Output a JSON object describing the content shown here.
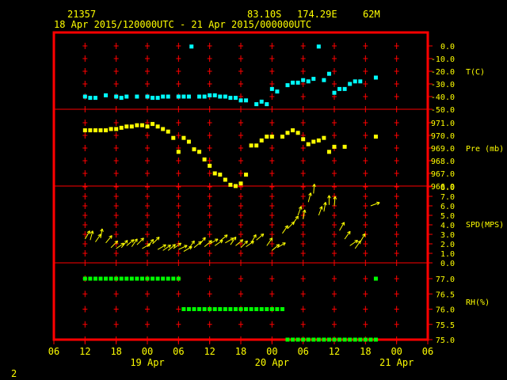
{
  "header": {
    "station": "21357",
    "latitude": "83.10S",
    "longitude": "174.29E",
    "elevation": "62M",
    "date_range": "18 Apr 2015/120000UTC - 21 Apr 2015/000000UTC"
  },
  "page_number": "2",
  "colors": {
    "background": "#000000",
    "frame": "#ff0000",
    "gridline": "#ff0000",
    "tick_labels": "#ffff00",
    "temperature": "#00ffff",
    "pressure": "#ffff00",
    "wind": "#ffff00",
    "humidity": "#00ff00"
  },
  "chart_data": {
    "type": "scatter",
    "x_axis": {
      "ticks": [
        "06",
        "12",
        "18",
        "00",
        "06",
        "12",
        "18",
        "00",
        "06",
        "12",
        "18",
        "00",
        "06"
      ],
      "day_labels": [
        "19 Apr",
        "20 Apr",
        "21 Apr"
      ],
      "range_hours_since_18Apr_00UTC": [
        6,
        78
      ]
    },
    "panels": [
      {
        "name": "temperature",
        "label": "T(C)",
        "ticks": [
          "0.0",
          "-10.0",
          "-20.0",
          "-30.0",
          "-40.0",
          "-50.0"
        ],
        "range": [
          -50,
          0
        ],
        "points": [
          [
            12,
            -40
          ],
          [
            13,
            -41
          ],
          [
            14,
            -41
          ],
          [
            16,
            -39
          ],
          [
            18,
            -40
          ],
          [
            19,
            -41
          ],
          [
            20,
            -40
          ],
          [
            22,
            -40
          ],
          [
            24,
            -40
          ],
          [
            25,
            -41
          ],
          [
            26,
            -41
          ],
          [
            27,
            -40
          ],
          [
            28,
            -40
          ],
          [
            30,
            -40
          ],
          [
            31,
            -40
          ],
          [
            32,
            -40
          ],
          [
            32.5,
            -0.5
          ],
          [
            34,
            -40
          ],
          [
            35,
            -40
          ],
          [
            36,
            -39
          ],
          [
            37,
            -39
          ],
          [
            38,
            -40
          ],
          [
            39,
            -40
          ],
          [
            40,
            -41
          ],
          [
            41,
            -41
          ],
          [
            42,
            -43
          ],
          [
            43,
            -43
          ],
          [
            45,
            -46
          ],
          [
            46,
            -44
          ],
          [
            47,
            -46
          ],
          [
            48,
            -34
          ],
          [
            49,
            -36
          ],
          [
            51,
            -31
          ],
          [
            52,
            -29
          ],
          [
            53,
            -29
          ],
          [
            54,
            -27
          ],
          [
            55,
            -28
          ],
          [
            56,
            -26
          ],
          [
            57,
            -0.5
          ],
          [
            58,
            -27
          ],
          [
            59,
            -22
          ],
          [
            60,
            -37
          ],
          [
            61,
            -34
          ],
          [
            62,
            -34
          ],
          [
            63,
            -30
          ],
          [
            64,
            -28
          ],
          [
            65,
            -28
          ],
          [
            68,
            -25
          ]
        ]
      },
      {
        "name": "pressure",
        "label": "Pre (mb)",
        "ticks": [
          "971.0",
          "970.0",
          "969.0",
          "968.0",
          "967.0",
          "966.0"
        ],
        "range": [
          966,
          971
        ],
        "points": [
          [
            12,
            970.4
          ],
          [
            13,
            970.4
          ],
          [
            14,
            970.4
          ],
          [
            15,
            970.4
          ],
          [
            16,
            970.4
          ],
          [
            17,
            970.5
          ],
          [
            18,
            970.5
          ],
          [
            19,
            970.6
          ],
          [
            20,
            970.7
          ],
          [
            21,
            970.7
          ],
          [
            22,
            970.8
          ],
          [
            23,
            970.8
          ],
          [
            24,
            970.7
          ],
          [
            25,
            970.9
          ],
          [
            26,
            970.7
          ],
          [
            27,
            970.5
          ],
          [
            28,
            970.3
          ],
          [
            29,
            969.8
          ],
          [
            30,
            968.7
          ],
          [
            31,
            969.8
          ],
          [
            32,
            969.5
          ],
          [
            33,
            968.9
          ],
          [
            34,
            968.7
          ],
          [
            35,
            968.1
          ],
          [
            36,
            967.6
          ],
          [
            37,
            967.0
          ],
          [
            38,
            966.9
          ],
          [
            39,
            966.5
          ],
          [
            40,
            966.1
          ],
          [
            41,
            966.0
          ],
          [
            42,
            966.2
          ],
          [
            43,
            966.9
          ],
          [
            44,
            969.2
          ],
          [
            45,
            969.2
          ],
          [
            46,
            969.6
          ],
          [
            47,
            969.9
          ],
          [
            48,
            969.9
          ],
          [
            50,
            969.9
          ],
          [
            51,
            970.2
          ],
          [
            52,
            970.4
          ],
          [
            53,
            970.2
          ],
          [
            54,
            969.7
          ],
          [
            55,
            969.3
          ],
          [
            56,
            969.5
          ],
          [
            57,
            969.6
          ],
          [
            58,
            969.8
          ],
          [
            59,
            968.7
          ],
          [
            60,
            969.1
          ],
          [
            62,
            969.1
          ],
          [
            68,
            969.9
          ]
        ]
      },
      {
        "name": "wind_speed",
        "label": "SPD(MPS)",
        "ticks": [
          "8.0",
          "7.0",
          "6.0",
          "5.0",
          "4.0",
          "3.0",
          "2.0",
          "1.0",
          "0.0"
        ],
        "range": [
          0,
          8
        ],
        "arrows": [
          [
            12,
            2.5,
            60
          ],
          [
            13,
            2.4,
            75
          ],
          [
            14,
            2.2,
            55
          ],
          [
            15,
            2.6,
            80
          ],
          [
            16,
            2.1,
            50
          ],
          [
            17,
            1.6,
            45
          ],
          [
            18,
            1.5,
            35
          ],
          [
            19,
            1.6,
            50
          ],
          [
            20,
            1.8,
            40
          ],
          [
            21,
            1.7,
            55
          ],
          [
            22,
            1.9,
            45
          ],
          [
            23,
            1.5,
            30
          ],
          [
            24,
            1.7,
            50
          ],
          [
            25,
            2.0,
            45
          ],
          [
            26,
            1.4,
            30
          ],
          [
            27,
            1.3,
            35
          ],
          [
            28,
            1.3,
            40
          ],
          [
            29,
            1.5,
            35
          ],
          [
            30,
            1.4,
            25
          ],
          [
            31,
            1.2,
            30
          ],
          [
            32,
            1.5,
            55
          ],
          [
            33,
            1.6,
            40
          ],
          [
            34,
            1.9,
            50
          ],
          [
            35,
            1.7,
            40
          ],
          [
            36,
            2.0,
            30
          ],
          [
            37,
            1.8,
            35
          ],
          [
            38,
            2.3,
            40
          ],
          [
            39,
            2.1,
            30
          ],
          [
            40,
            1.9,
            55
          ],
          [
            41,
            1.8,
            40
          ],
          [
            42,
            1.6,
            45
          ],
          [
            43,
            1.7,
            35
          ],
          [
            44,
            2.1,
            60
          ],
          [
            45,
            2.4,
            40
          ],
          [
            47,
            1.8,
            55
          ],
          [
            48,
            1.3,
            40
          ],
          [
            49,
            1.6,
            30
          ],
          [
            50,
            3.1,
            55
          ],
          [
            51,
            3.6,
            45
          ],
          [
            52,
            4.1,
            55
          ],
          [
            53,
            5.0,
            70
          ],
          [
            54,
            4.6,
            80
          ],
          [
            55,
            6.4,
            75
          ],
          [
            56,
            7.3,
            85
          ],
          [
            57,
            5.0,
            70
          ],
          [
            58,
            5.4,
            80
          ],
          [
            59,
            6.1,
            90
          ],
          [
            60,
            6.0,
            85
          ],
          [
            61,
            3.4,
            60
          ],
          [
            62,
            2.5,
            55
          ],
          [
            63,
            1.8,
            35
          ],
          [
            64,
            1.5,
            55
          ],
          [
            65,
            2.2,
            60
          ],
          [
            67,
            6.0,
            20
          ]
        ]
      },
      {
        "name": "relative_humidity",
        "label": "RH(%)",
        "ticks": [
          "77.0",
          "76.5",
          "76.0",
          "75.5",
          "75.0"
        ],
        "range": [
          75,
          77
        ],
        "points": [
          [
            12,
            77
          ],
          [
            13,
            77
          ],
          [
            14,
            77
          ],
          [
            15,
            77
          ],
          [
            16,
            77
          ],
          [
            17,
            77
          ],
          [
            18,
            77
          ],
          [
            19,
            77
          ],
          [
            20,
            77
          ],
          [
            21,
            77
          ],
          [
            22,
            77
          ],
          [
            23,
            77
          ],
          [
            24,
            77
          ],
          [
            25,
            77
          ],
          [
            26,
            77
          ],
          [
            27,
            77
          ],
          [
            28,
            77
          ],
          [
            29,
            77
          ],
          [
            30,
            77
          ],
          [
            31,
            76
          ],
          [
            32,
            76
          ],
          [
            33,
            76
          ],
          [
            34,
            76
          ],
          [
            35,
            76
          ],
          [
            36,
            76
          ],
          [
            37,
            76
          ],
          [
            38,
            76
          ],
          [
            39,
            76
          ],
          [
            40,
            76
          ],
          [
            41,
            76
          ],
          [
            42,
            76
          ],
          [
            43,
            76
          ],
          [
            44,
            76
          ],
          [
            45,
            76
          ],
          [
            46,
            76
          ],
          [
            47,
            76
          ],
          [
            48,
            76
          ],
          [
            49,
            76
          ],
          [
            50,
            76
          ],
          [
            51,
            75
          ],
          [
            52,
            75
          ],
          [
            53,
            75
          ],
          [
            54,
            75
          ],
          [
            55,
            75
          ],
          [
            56,
            75
          ],
          [
            57,
            75
          ],
          [
            58,
            75
          ],
          [
            59,
            75
          ],
          [
            60,
            75
          ],
          [
            61,
            75
          ],
          [
            62,
            75
          ],
          [
            63,
            75
          ],
          [
            64,
            75
          ],
          [
            65,
            75
          ],
          [
            66,
            75
          ],
          [
            67,
            75
          ],
          [
            68,
            75
          ],
          [
            68,
            77
          ]
        ]
      }
    ]
  }
}
